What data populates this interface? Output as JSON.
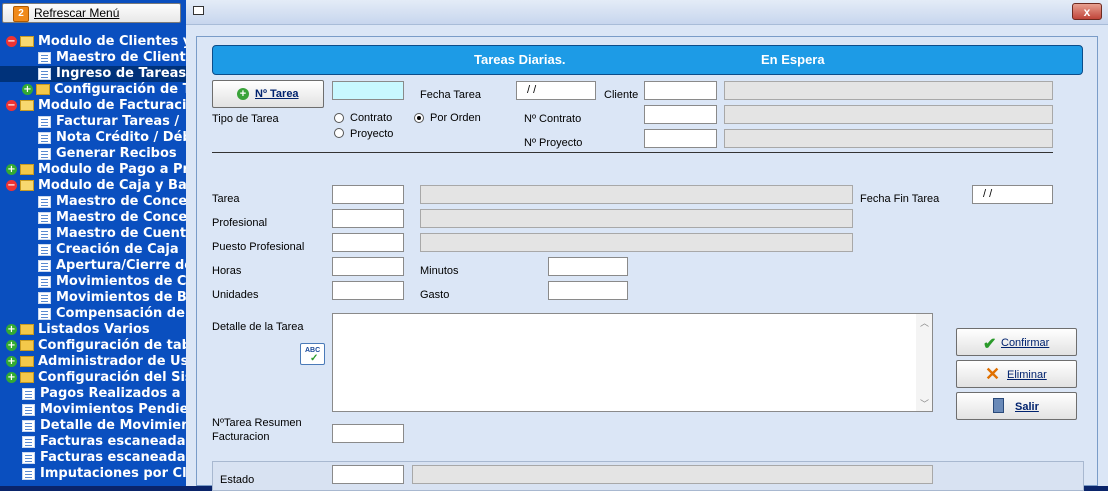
{
  "menu": {
    "refresh_label": "Refrescar Menú",
    "items": [
      {
        "label": "Modulo de Clientes y",
        "kind": "folder-open",
        "exp": "minus"
      },
      {
        "label": "Maestro de Clientes",
        "kind": "doc"
      },
      {
        "label": "Ingreso de Tareas",
        "kind": "doc",
        "selected": true
      },
      {
        "label": "Configuración de T",
        "kind": "folder",
        "exp": "plus"
      },
      {
        "label": "Modulo de Facturación",
        "kind": "folder-open",
        "exp": "minus"
      },
      {
        "label": "Facturar Tareas / ",
        "kind": "doc"
      },
      {
        "label": "Nota Crédito / Déb",
        "kind": "doc"
      },
      {
        "label": "Generar Recibos",
        "kind": "doc"
      },
      {
        "label": "Modulo de Pago a Pr",
        "kind": "folder",
        "exp": "plus"
      },
      {
        "label": "Modulo de Caja y Ba",
        "kind": "folder-open",
        "exp": "minus"
      },
      {
        "label": "Maestro de Concep",
        "kind": "doc"
      },
      {
        "label": "Maestro de Concep",
        "kind": "doc"
      },
      {
        "label": "Maestro de Cuenta",
        "kind": "doc"
      },
      {
        "label": "Creación de Caja",
        "kind": "doc"
      },
      {
        "label": "Apertura/Cierre de",
        "kind": "doc"
      },
      {
        "label": "Movimientos de Ca",
        "kind": "doc"
      },
      {
        "label": "Movimientos de Ba",
        "kind": "doc"
      },
      {
        "label": "Compensación de",
        "kind": "doc"
      },
      {
        "label": "Listados Varios",
        "kind": "folder",
        "exp": "plus",
        "top": true
      },
      {
        "label": "Configuración de tab",
        "kind": "folder",
        "exp": "plus",
        "top": true
      },
      {
        "label": "Administrador de Usu",
        "kind": "folder",
        "exp": "plus",
        "top": true
      },
      {
        "label": "Configuración del Sis",
        "kind": "folder",
        "exp": "plus",
        "top": true
      },
      {
        "label": "Pagos Realizados a",
        "kind": "doc",
        "root": true
      },
      {
        "label": "Movimientos Pendie",
        "kind": "doc",
        "root": true
      },
      {
        "label": "Detalle de Movimien",
        "kind": "doc",
        "root": true
      },
      {
        "label": "Facturas escaneada",
        "kind": "doc",
        "root": true
      },
      {
        "label": "Facturas escaneada",
        "kind": "doc",
        "root": true
      },
      {
        "label": "Imputaciones por Cl",
        "kind": "doc",
        "root": true
      }
    ]
  },
  "window": {
    "close_label": "x"
  },
  "form": {
    "header_left": "Tareas Diarias.",
    "header_right": "En Espera",
    "ntarea_button": "Nº Tarea",
    "ntarea_value": "",
    "fecha_tarea_label": "Fecha Tarea",
    "fecha_tarea_value": "/ /",
    "cliente_label": "Cliente",
    "tipo_tarea_label": "Tipo de Tarea",
    "radio_contrato": "Contrato",
    "radio_proyecto": "Proyecto",
    "radio_por_orden": "Por Orden",
    "ncontrato_label": "Nº Contrato",
    "nproyecto_label": "Nº Proyecto",
    "tarea_label": "Tarea",
    "fecha_fin_label": "Fecha Fin Tarea",
    "fecha_fin_value": "/ /",
    "profesional_label": "Profesional",
    "puesto_label": "Puesto Profesional",
    "horas_label": "Horas",
    "minutos_label": "Minutos",
    "unidades_label": "Unidades",
    "gasto_label": "Gasto",
    "detalle_label": "Detalle de la Tarea",
    "resumen_label_1": "NºTarea Resumen",
    "resumen_label_2": "Facturacion",
    "estado_label": "Estado",
    "confirmar": "Confirmar",
    "eliminar": "Eliminar",
    "salir": "Salir",
    "spell_icon_text": "ABC"
  },
  "colors": {
    "header": "#1d9be6",
    "menu_bg": "#0a4fbf",
    "focus_field": "#c8f8ff"
  }
}
